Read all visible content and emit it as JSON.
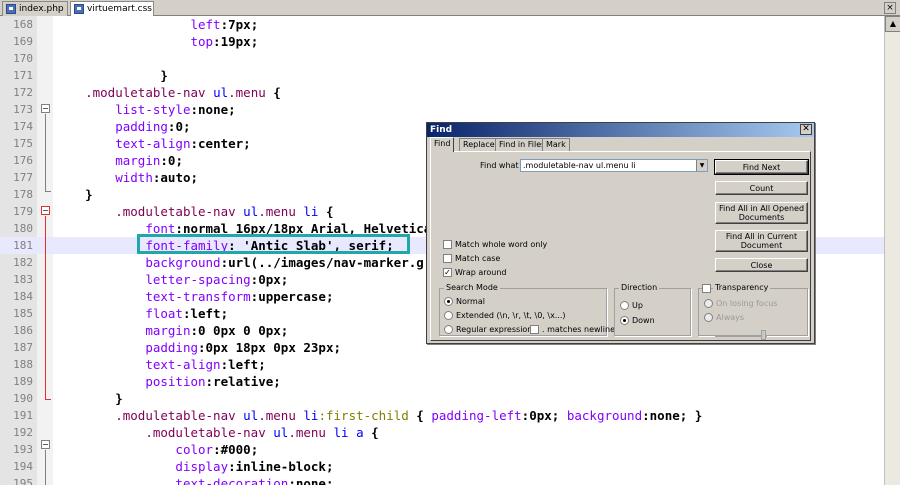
{
  "tabs": [
    {
      "label": "index.php",
      "active": false
    },
    {
      "label": "virtuemart.css",
      "active": true
    }
  ],
  "editor": {
    "lines": [
      {
        "num": "168",
        "tokens": [
          [
            "",
            "                  "
          ],
          [
            "prop",
            "left"
          ],
          [
            "pun",
            ":"
          ],
          [
            "val",
            "7px"
          ],
          [
            "pun",
            ";"
          ]
        ]
      },
      {
        "num": "169",
        "tokens": [
          [
            "",
            "                  "
          ],
          [
            "prop",
            "top"
          ],
          [
            "pun",
            ":"
          ],
          [
            "val",
            "19px"
          ],
          [
            "pun",
            ";"
          ]
        ]
      },
      {
        "num": "170",
        "tokens": []
      },
      {
        "num": "171",
        "tokens": [
          [
            "",
            "              "
          ],
          [
            "pun",
            "}"
          ]
        ]
      },
      {
        "num": "172",
        "tokens": [
          [
            "",
            "    "
          ],
          [
            "sel",
            ".moduletable-nav"
          ],
          [
            "",
            " "
          ],
          [
            "ele",
            "ul"
          ],
          [
            "sel",
            ".menu"
          ],
          [
            "",
            " "
          ],
          [
            "pun",
            "{"
          ]
        ]
      },
      {
        "num": "173",
        "tokens": [
          [
            "",
            "        "
          ],
          [
            "prop",
            "list-style"
          ],
          [
            "pun",
            ":"
          ],
          [
            "val",
            "none"
          ],
          [
            "pun",
            ";"
          ]
        ]
      },
      {
        "num": "174",
        "tokens": [
          [
            "",
            "        "
          ],
          [
            "prop",
            "padding"
          ],
          [
            "pun",
            ":"
          ],
          [
            "val",
            "0"
          ],
          [
            "pun",
            ";"
          ]
        ]
      },
      {
        "num": "175",
        "tokens": [
          [
            "",
            "        "
          ],
          [
            "prop",
            "text-align"
          ],
          [
            "pun",
            ":"
          ],
          [
            "val",
            "center"
          ],
          [
            "pun",
            ";"
          ]
        ]
      },
      {
        "num": "176",
        "tokens": [
          [
            "",
            "        "
          ],
          [
            "prop",
            "margin"
          ],
          [
            "pun",
            ":"
          ],
          [
            "val",
            "0"
          ],
          [
            "pun",
            ";"
          ]
        ]
      },
      {
        "num": "177",
        "tokens": [
          [
            "",
            "        "
          ],
          [
            "prop",
            "width"
          ],
          [
            "pun",
            ":"
          ],
          [
            "val",
            "auto"
          ],
          [
            "pun",
            ";"
          ]
        ]
      },
      {
        "num": "178",
        "tokens": [
          [
            "",
            "    "
          ],
          [
            "pun",
            "}"
          ]
        ]
      },
      {
        "num": "179",
        "tokens": [
          [
            "",
            "        "
          ],
          [
            "sel",
            ".moduletable-nav"
          ],
          [
            "",
            " "
          ],
          [
            "ele",
            "ul"
          ],
          [
            "sel",
            ".menu"
          ],
          [
            "",
            " "
          ],
          [
            "ele",
            "li"
          ],
          [
            "",
            " "
          ],
          [
            "pun",
            "{"
          ]
        ]
      },
      {
        "num": "180",
        "tokens": [
          [
            "",
            "            "
          ],
          [
            "prop",
            "font"
          ],
          [
            "pun",
            ":"
          ],
          [
            "val",
            "normal 16px/18px Arial, Helvetica"
          ]
        ]
      },
      {
        "num": "181",
        "tokens": [
          [
            "",
            "            "
          ],
          [
            "prop",
            "font-family"
          ],
          [
            "pun",
            ": "
          ],
          [
            "val",
            "'Antic Slab'"
          ],
          [
            "pun",
            ", "
          ],
          [
            "val",
            "serif"
          ],
          [
            "pun",
            ";"
          ]
        ],
        "current": true
      },
      {
        "num": "182",
        "tokens": [
          [
            "",
            "            "
          ],
          [
            "prop",
            "background"
          ],
          [
            "pun",
            ":"
          ],
          [
            "val",
            "url(../images/nav-marker.g"
          ]
        ]
      },
      {
        "num": "183",
        "tokens": [
          [
            "",
            "            "
          ],
          [
            "prop",
            "letter-spacing"
          ],
          [
            "pun",
            ":"
          ],
          [
            "val",
            "0px"
          ],
          [
            "pun",
            ";"
          ]
        ]
      },
      {
        "num": "184",
        "tokens": [
          [
            "",
            "            "
          ],
          [
            "prop",
            "text-transform"
          ],
          [
            "pun",
            ":"
          ],
          [
            "val",
            "uppercase"
          ],
          [
            "pun",
            ";"
          ]
        ]
      },
      {
        "num": "185",
        "tokens": [
          [
            "",
            "            "
          ],
          [
            "prop",
            "float"
          ],
          [
            "pun",
            ":"
          ],
          [
            "val",
            "left"
          ],
          [
            "pun",
            ";"
          ]
        ]
      },
      {
        "num": "186",
        "tokens": [
          [
            "",
            "            "
          ],
          [
            "prop",
            "margin"
          ],
          [
            "pun",
            ":"
          ],
          [
            "val",
            "0 0px 0 0px"
          ],
          [
            "pun",
            ";"
          ]
        ]
      },
      {
        "num": "187",
        "tokens": [
          [
            "",
            "            "
          ],
          [
            "prop",
            "padding"
          ],
          [
            "pun",
            ":"
          ],
          [
            "val",
            "0px 18px 0px 23px"
          ],
          [
            "pun",
            ";"
          ]
        ]
      },
      {
        "num": "188",
        "tokens": [
          [
            "",
            "            "
          ],
          [
            "prop",
            "text-align"
          ],
          [
            "pun",
            ":"
          ],
          [
            "val",
            "left"
          ],
          [
            "pun",
            ";"
          ]
        ]
      },
      {
        "num": "189",
        "tokens": [
          [
            "",
            "            "
          ],
          [
            "prop",
            "position"
          ],
          [
            "pun",
            ":"
          ],
          [
            "val",
            "relative"
          ],
          [
            "pun",
            ";"
          ]
        ]
      },
      {
        "num": "190",
        "tokens": [
          [
            "",
            "        "
          ],
          [
            "pun",
            "}"
          ]
        ]
      },
      {
        "num": "191",
        "tokens": [
          [
            "",
            "        "
          ],
          [
            "sel",
            ".moduletable-nav"
          ],
          [
            "",
            " "
          ],
          [
            "ele",
            "ul"
          ],
          [
            "sel",
            ".menu"
          ],
          [
            "",
            " "
          ],
          [
            "ele",
            "li"
          ],
          [
            "pse",
            ":first-child"
          ],
          [
            "pun",
            " { "
          ],
          [
            "prop",
            "padding-left"
          ],
          [
            "pun",
            ":"
          ],
          [
            "val",
            "0px"
          ],
          [
            "pun",
            "; "
          ],
          [
            "prop",
            "background"
          ],
          [
            "pun",
            ":"
          ],
          [
            "val",
            "none"
          ],
          [
            "pun",
            "; }"
          ]
        ]
      },
      {
        "num": "192",
        "tokens": [
          [
            "",
            "            "
          ],
          [
            "sel",
            ".moduletable-nav"
          ],
          [
            "",
            " "
          ],
          [
            "ele",
            "ul"
          ],
          [
            "sel",
            ".menu"
          ],
          [
            "",
            " "
          ],
          [
            "ele",
            "li"
          ],
          [
            "",
            " "
          ],
          [
            "ele",
            "a"
          ],
          [
            "",
            " "
          ],
          [
            "pun",
            "{"
          ]
        ]
      },
      {
        "num": "193",
        "tokens": [
          [
            "",
            "                "
          ],
          [
            "prop",
            "color"
          ],
          [
            "pun",
            ":"
          ],
          [
            "val",
            "#000"
          ],
          [
            "pun",
            ";"
          ]
        ]
      },
      {
        "num": "194",
        "tokens": [
          [
            "",
            "                "
          ],
          [
            "prop",
            "display"
          ],
          [
            "pun",
            ":"
          ],
          [
            "val",
            "inline-block"
          ],
          [
            "pun",
            ";"
          ]
        ]
      },
      {
        "num": "195",
        "tokens": [
          [
            "",
            "                "
          ],
          [
            "prop",
            "text-decoration"
          ],
          [
            "pun",
            ":"
          ],
          [
            "val",
            "none"
          ],
          [
            "pun",
            ";"
          ]
        ]
      }
    ]
  },
  "find_dialog": {
    "title": "Find",
    "close_glyph": "✕",
    "tabs": [
      "Find",
      "Replace",
      "Find in Files",
      "Mark"
    ],
    "find_what_label": "Find what :",
    "find_what_value": ".moduletable-nav ul.menu li",
    "buttons": {
      "find_next": "Find Next",
      "count": "Count",
      "find_all_opened": "Find All in All Opened Documents",
      "find_all_current": "Find All in Current Document",
      "close": "Close"
    },
    "options": {
      "whole_word": "Match whole word only",
      "match_case": "Match case",
      "wrap_around": "Wrap around"
    },
    "search_mode": {
      "title": "Search Mode",
      "normal": "Normal",
      "extended": "Extended (\\n, \\r, \\t, \\0, \\x...)",
      "regex": "Regular expression",
      "matches_newline": ". matches newline"
    },
    "direction": {
      "title": "Direction",
      "up": "Up",
      "down": "Down"
    },
    "transparency": {
      "title": "Transparency",
      "on_losing_focus": "On losing focus",
      "always": "Always"
    }
  }
}
